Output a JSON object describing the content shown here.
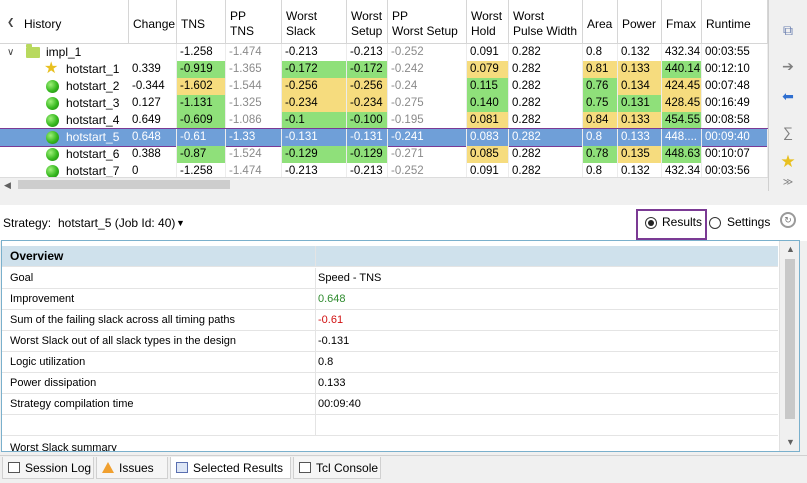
{
  "history": {
    "columns": [
      {
        "label": "History"
      },
      {
        "label": "Change"
      },
      {
        "label": "TNS"
      },
      {
        "label": "PP\nTNS"
      },
      {
        "label": "Worst\nSlack"
      },
      {
        "label": "Worst\nSetup"
      },
      {
        "label": "PP\nWorst Setup"
      },
      {
        "label": "Worst\nHold"
      },
      {
        "label": "Worst\nPulse Width"
      },
      {
        "label": "Area"
      },
      {
        "label": "Power"
      },
      {
        "label": "Fmax"
      },
      {
        "label": "Runtime"
      }
    ],
    "rows": [
      {
        "name": "impl_1",
        "icon": "folder-icon",
        "level": 0,
        "values": [
          "",
          "-1.258",
          "-1.474",
          "-0.213",
          "-0.213",
          "-0.252",
          "0.091",
          "0.282",
          "0.8",
          "0.132",
          "432.34",
          "00:03:55"
        ]
      },
      {
        "name": "hotstart_1",
        "icon": "star-icon",
        "level": 1,
        "values": [
          "0.339",
          "-0.919",
          "-1.365",
          "-0.172",
          "-0.172",
          "-0.242",
          "0.079",
          "0.282",
          "0.81",
          "0.133",
          "440.14",
          "00:12:10"
        ]
      },
      {
        "name": "hotstart_2",
        "icon": "green-ball-icon",
        "level": 1,
        "values": [
          "-0.344",
          "-1.602",
          "-1.544",
          "-0.256",
          "-0.256",
          "-0.24",
          "0.115",
          "0.282",
          "0.76",
          "0.134",
          "424.45",
          "00:07:48"
        ]
      },
      {
        "name": "hotstart_3",
        "icon": "green-ball-icon",
        "level": 1,
        "values": [
          "0.127",
          "-1.131",
          "-1.325",
          "-0.234",
          "-0.234",
          "-0.275",
          "0.140",
          "0.282",
          "0.75",
          "0.131",
          "428.45",
          "00:16:49"
        ]
      },
      {
        "name": "hotstart_4",
        "icon": "green-ball-icon",
        "level": 1,
        "values": [
          "0.649",
          "-0.609",
          "-1.086",
          "-0.1",
          "-0.100",
          "-0.195",
          "0.081",
          "0.282",
          "0.84",
          "0.133",
          "454.55",
          "00:08:58"
        ]
      },
      {
        "name": "hotstart_5",
        "icon": "green-ball-icon",
        "level": 1,
        "selected": true,
        "values": [
          "0.648",
          "-0.61",
          "-1.33",
          "-0.131",
          "-0.131",
          "-0.241",
          "0.083",
          "0.282",
          "0.8",
          "0.133",
          "448....",
          "00:09:40"
        ]
      },
      {
        "name": "hotstart_6",
        "icon": "green-ball-icon",
        "level": 1,
        "values": [
          "0.388",
          "-0.87",
          "-1.524",
          "-0.129",
          "-0.129",
          "-0.271",
          "0.085",
          "0.282",
          "0.78",
          "0.135",
          "448.63",
          "00:10:07"
        ]
      },
      {
        "name": "hotstart_7",
        "icon": "green-ball-icon",
        "level": 1,
        "values": [
          "0",
          "-1.258",
          "-1.474",
          "-0.213",
          "-0.213",
          "-0.252",
          "0.091",
          "0.282",
          "0.8",
          "0.132",
          "432.34",
          "00:03:56"
        ]
      }
    ],
    "highlight_colors": {
      "good": "#8fe07a",
      "warn": "#f6dc7e",
      "selected": "#6f9fd8",
      "selected_outline": "#7b3a94"
    }
  },
  "toolbar_right": [
    "copy-icon",
    "arrow-right-icon",
    "arrow-left-icon",
    "report-icon",
    "star-icon",
    "expand-icon"
  ],
  "strategy": {
    "label": "Strategy:",
    "value": "hotstart_5 (Job Id: 40)",
    "results_label": "Results",
    "settings_label": "Settings",
    "results_selected": true
  },
  "overview": {
    "title": "Overview",
    "rows": [
      {
        "key": "Goal",
        "value": "Speed - TNS"
      },
      {
        "key": "Improvement",
        "value": "0.648",
        "color": "#2e8b2e"
      },
      {
        "key": "Sum of the failing slack across all timing paths",
        "value": "-0.61",
        "color": "#d11010"
      },
      {
        "key": "Worst Slack out of all slack types in the design",
        "value": "-0.131"
      },
      {
        "key": "Logic utilization",
        "value": "0.8"
      },
      {
        "key": "Power dissipation",
        "value": "0.133"
      },
      {
        "key": "Strategy compilation time",
        "value": "00:09:40"
      }
    ],
    "next_section": "Worst Slack summary"
  },
  "bottom_tabs": [
    {
      "label": "Session Log",
      "icon": "log-icon"
    },
    {
      "label": "Issues",
      "icon": "warning-icon"
    },
    {
      "label": "Selected Results",
      "icon": "results-icon",
      "active": true
    },
    {
      "label": "Tcl Console",
      "icon": "console-icon"
    }
  ]
}
